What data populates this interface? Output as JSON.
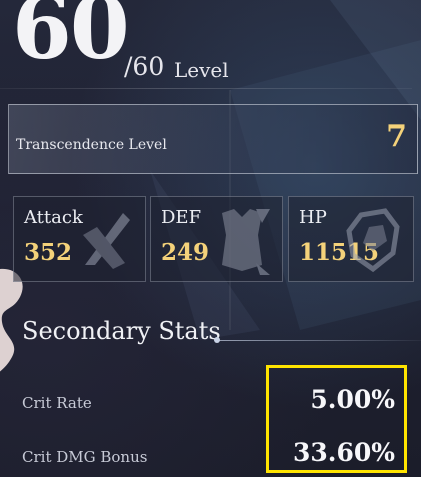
{
  "level": {
    "current": "60",
    "max": "/60",
    "word": "Level"
  },
  "transcendence": {
    "label": "Transcendence Level",
    "value": "7"
  },
  "stats": [
    {
      "label": "Attack",
      "value": "352",
      "icon": "sword-icon"
    },
    {
      "label": "DEF",
      "value": "249",
      "icon": "armor-icon"
    },
    {
      "label": "HP",
      "value": "11515",
      "icon": "shield-icon"
    }
  ],
  "secondary": {
    "title": "Secondary Stats",
    "rows": [
      {
        "label": "Crit Rate",
        "value": "5.00%"
      },
      {
        "label": "Crit DMG Bonus",
        "value": "33.60%"
      }
    ]
  },
  "colors": {
    "accent_gold": "#f4d27a",
    "highlight": "#ffe400",
    "background": "#1f2233"
  }
}
